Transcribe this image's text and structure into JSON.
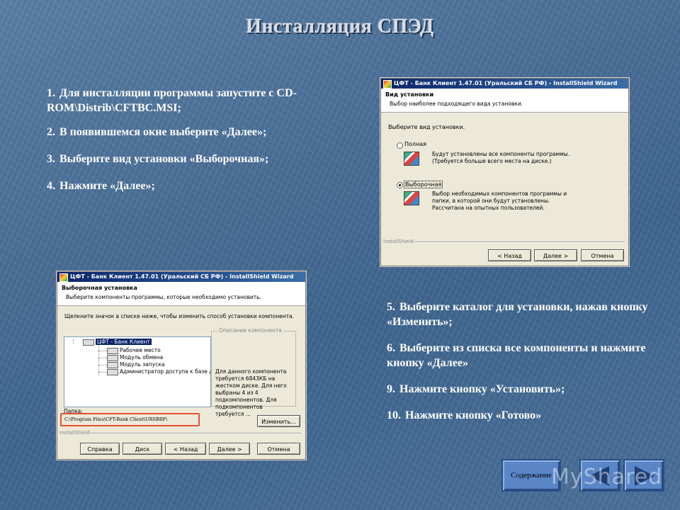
{
  "title": "Инсталляция СПЭД",
  "steps_left": [
    {
      "num": "1.",
      "text": "Для инсталляции программы запустите с CD-ROM\\Distrib\\CFTBC.MSI;"
    },
    {
      "num": "2.",
      "text": "В появившемся окне выберите «Далее»;"
    },
    {
      "num": "3.",
      "text": "Выберите вид установки «Выборочная»;"
    },
    {
      "num": "4.",
      "text": "Нажмите «Далее»;"
    }
  ],
  "steps_right": [
    {
      "num": "5.",
      "text": "Выберите каталог для установки, нажав кнопку «Изменить»;"
    },
    {
      "num": "6.",
      "text": "Выберите из списка все компоненты и нажмите кнопку «Далее»"
    },
    {
      "num": "9.",
      "text": "Нажмите кнопку «Установить»;"
    },
    {
      "num": "10.",
      "text": "Нажмите кнопку «Готово»"
    }
  ],
  "setup_window": {
    "title": "ЦФТ - Банк Клиент 1.47.01 (Уральский СБ РФ) - InstallShield Wizard",
    "header": "Вид установки",
    "subheader": "Выбор наиболее подходящего вида установки.",
    "prompt": "Выберите вид установки.",
    "options": [
      {
        "label": "Полная",
        "desc": "Будут установлены все компоненты программы. (Требуется больше всего места на диске.)",
        "selected": false
      },
      {
        "label": "Выборочная",
        "desc": "Выбор необходимых компонентов программы и папки, в которой они будут установлены. Рассчитана на опытных пользователей.",
        "selected": true
      }
    ],
    "footer_label": "InstallShield",
    "buttons": {
      "back": "< Назад",
      "next": "Далее >",
      "cancel": "Отмена"
    }
  },
  "custom_window": {
    "title": "ЦФТ - Банк Клиент 1.47.01 (Уральский СБ РФ) - InstallShield Wizard",
    "header": "Выборочная установка",
    "subheader": "Выберите компоненты программы, которые необходимо установить.",
    "prompt": "Щелкните значок в списке ниже, чтобы изменить способ установки компонента.",
    "tree": [
      "ЦФТ - Банк Клиент",
      "Рабочее место",
      "Модуль обмена",
      "Модуль запуска",
      "Администратор доступа к базе дан"
    ],
    "desc_title": "Описание компонента",
    "desc_text": "Для данного компонента требуется 6843КБ на жестком диске. Для него выбраны 4 из 4 подкомпонентов. Для подкомпонентов требуется ...",
    "folder_label": "Папка:",
    "folder_path": "C:\\Program Files\\CFT-Bank Client\\URSBRF\\",
    "change_button": "Изменить...",
    "footer_label": "InstallShield",
    "buttons": {
      "help": "Справка",
      "disk": "Диск",
      "back": "< Назад",
      "next": "Далее >",
      "cancel": "Отмена"
    }
  },
  "nav": {
    "contents": "Содержание"
  },
  "watermark": "MyShared"
}
